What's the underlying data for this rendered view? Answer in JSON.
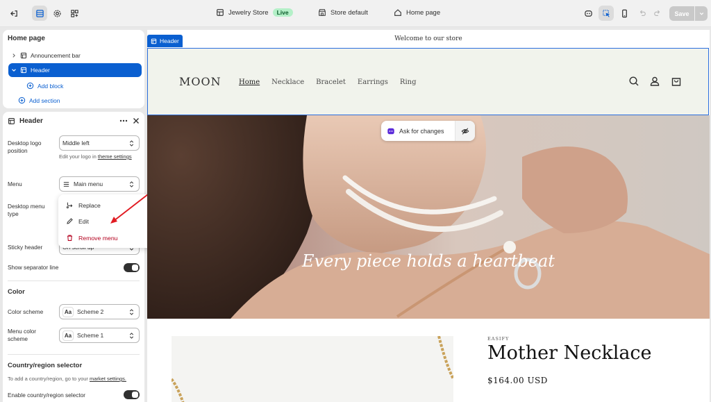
{
  "topbar": {
    "store_name": "Jewelry Store",
    "live_badge": "Live",
    "theme_name": "Store default",
    "page_name": "Home page",
    "save_label": "Save"
  },
  "sections_panel": {
    "title": "Home page",
    "items": [
      {
        "label": "Announcement bar"
      },
      {
        "label": "Header"
      }
    ],
    "add_block": "Add block",
    "add_section": "Add section"
  },
  "settings_panel": {
    "title": "Header",
    "desktop_logo_position_label": "Desktop logo position",
    "desktop_logo_position_value": "Middle left",
    "logo_hint_prefix": "Edit your logo in ",
    "logo_hint_link": "theme settings",
    "menu_label": "Menu",
    "menu_value": "Main menu",
    "desktop_menu_type_label": "Desktop menu type",
    "sticky_header_label": "Sticky header",
    "sticky_header_value": "On scroll up",
    "show_separator_label": "Show separator line",
    "show_separator_on": true,
    "color_group_title": "Color",
    "color_scheme_label": "Color scheme",
    "color_scheme_value": "Scheme 2",
    "menu_color_scheme_label": "Menu color scheme",
    "menu_color_scheme_value": "Scheme 1",
    "swatch_text": "Aa",
    "country_group_title": "Country/region selector",
    "country_hint_prefix": "To add a country/region, go to your ",
    "country_hint_link": "market settings.",
    "enable_country_label": "Enable country/region selector",
    "enable_country_on": true
  },
  "menu_dropdown": {
    "items": [
      {
        "label": "Replace",
        "icon": "replace-icon"
      },
      {
        "label": "Edit",
        "icon": "pencil-icon"
      },
      {
        "label": "Remove menu",
        "icon": "trash-icon"
      }
    ]
  },
  "preview": {
    "announcement": "Welcome to our store",
    "header_tag": "Header",
    "logo": "MOON",
    "nav": [
      "Home",
      "Necklace",
      "Bracelet",
      "Earrings",
      "Ring"
    ],
    "hero_text": "Every piece holds a heartbeat",
    "ask_button": "Ask for changes",
    "product_brand": "EASIFY",
    "product_title": "Mother Necklace",
    "product_price": "$164.00 USD"
  },
  "colors": {
    "accent": "#0a5fd0",
    "danger": "#b3001e",
    "live_badge": "#b4f0c8",
    "header_bg": "#f1f3ec"
  }
}
